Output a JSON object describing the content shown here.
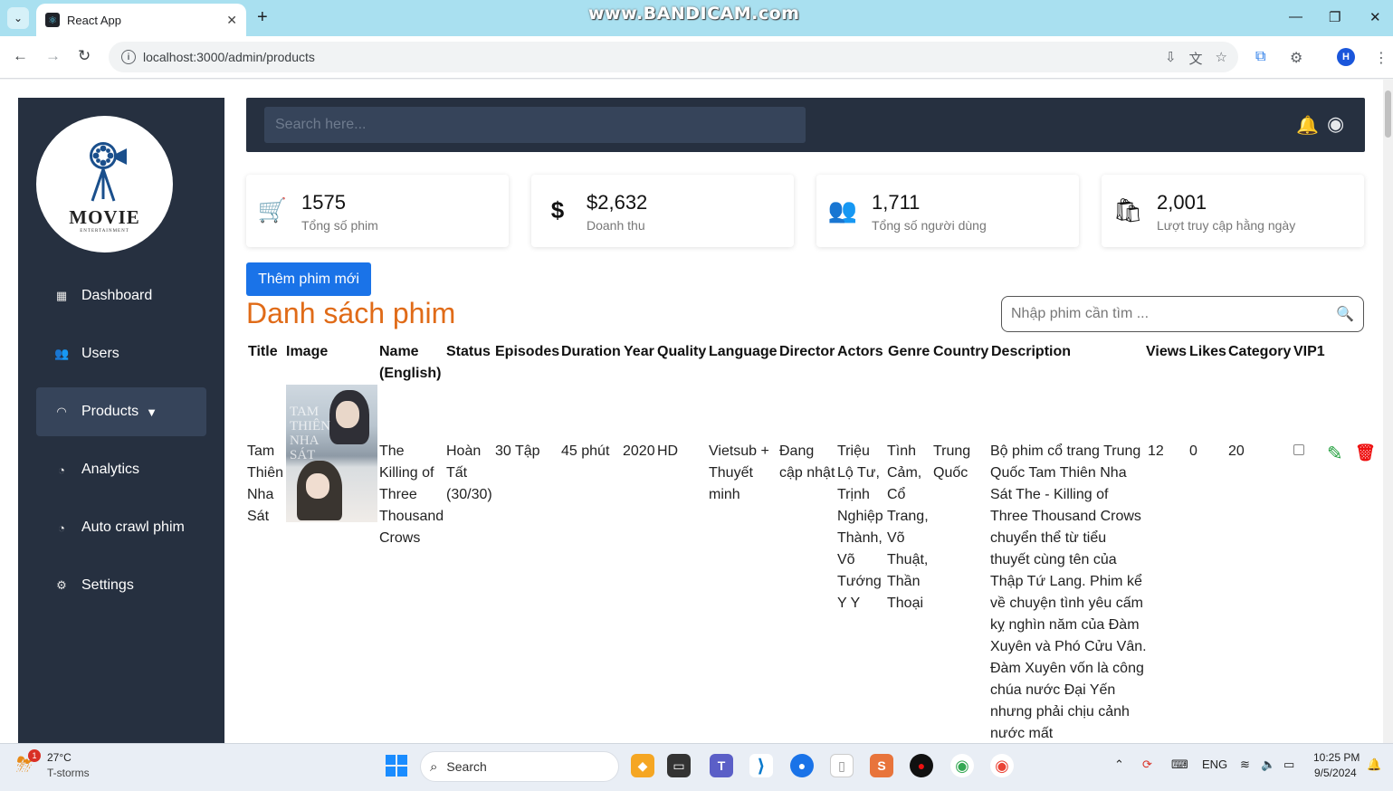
{
  "browser": {
    "tab_title": "React App",
    "url": "localhost:3000/admin/products",
    "watermark": "www.BANDICAM.com",
    "profile_initial": "H"
  },
  "sidebar": {
    "logo_text": "MOVIE",
    "logo_sub": "ENTERTAINMENT",
    "items": [
      {
        "label": "Dashboard",
        "icon": "dashboard-icon"
      },
      {
        "label": "Users",
        "icon": "users-icon"
      },
      {
        "label": "Products",
        "icon": "products-icon",
        "active": true
      },
      {
        "label": "Analytics",
        "icon": "analytics-icon"
      },
      {
        "label": "Auto crawl phim",
        "icon": "crawl-icon"
      },
      {
        "label": "Settings",
        "icon": "settings-icon"
      }
    ]
  },
  "topnav": {
    "search_placeholder": "Search here..."
  },
  "stats": [
    {
      "value": "1575",
      "label": "Tổng số phim",
      "icon": "cart-icon"
    },
    {
      "value": "$2,632",
      "label": "Doanh thu",
      "icon": "dollar-icon"
    },
    {
      "value": "1,711",
      "label": "Tổng số người dùng",
      "icon": "users-icon"
    },
    {
      "value": "2,001",
      "label": "Lượt truy cập hằng ngày",
      "icon": "bag-icon"
    }
  ],
  "main": {
    "add_button": "Thêm phim mới",
    "title": "Danh sách phim",
    "film_search_placeholder": "Nhập phim cần tìm ..."
  },
  "table": {
    "headers": {
      "title": "Title",
      "image": "Image",
      "name_en": "Name (English)",
      "status": "Status",
      "episodes": "Episodes",
      "duration": "Duration",
      "year": "Year",
      "quality": "Quality",
      "language": "Language",
      "director": "Director",
      "actors": "Actors",
      "genre": "Genre",
      "country": "Country",
      "description": "Description",
      "views": "Views",
      "likes": "Likes",
      "category": "Category",
      "vip": "VIP1"
    },
    "row": {
      "title": "Tam Thiên Nha Sát",
      "name_en": "The Killing of Three Thousand Crows",
      "status": "Hoàn Tất (30/30)",
      "episodes": "30 Tập",
      "duration": "45 phút",
      "year": "2020",
      "quality": "HD",
      "language": "Vietsub + Thuyết minh",
      "director": "Đang cập nhật",
      "actors": "Triệu Lộ Tư, Trịnh Nghiệp Thành, Võ Tướng Y Y",
      "genre": "Tình Cảm, Cổ Trang, Võ Thuật, Thần Thoại",
      "country": "Trung Quốc",
      "description": "Bộ phim cổ trang Trung Quốc Tam Thiên Nha Sát The - Killing of Three Thousand Crows chuyển thể từ tiểu thuyết cùng tên của Thập Tứ Lang. Phim kể về chuyện tình yêu cấm kỵ nghìn năm của Đàm Xuyên và Phó Cửu Vân. Đàm Xuyên vốn là công chúa nước Đại Yến nhưng phải chịu cảnh nước mất",
      "views": "12",
      "likes": "0",
      "category": "20",
      "poster_text": "TAM THIÊN NHA SÁT"
    }
  },
  "taskbar": {
    "weather_temp": "27°C",
    "weather_desc": "T-storms",
    "weather_badge": "1",
    "search_label": "Search",
    "language": "ENG",
    "time": "10:25 PM",
    "date": "9/5/2024"
  }
}
